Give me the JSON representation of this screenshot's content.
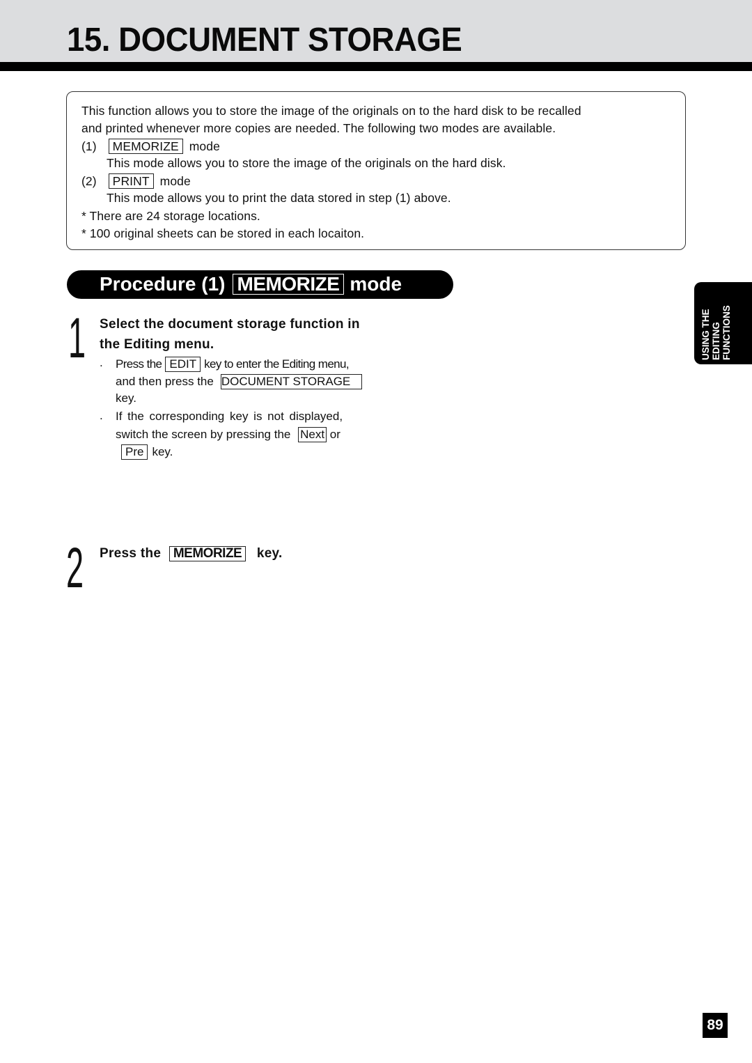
{
  "header": {
    "title": "15. DOCUMENT STORAGE"
  },
  "intro": {
    "line1": "This function allows you to store the image of the originals on to the hard disk to be recalled",
    "line2": "and printed whenever more copies are needed. The following two modes are available.",
    "mode1": {
      "num": "(1)",
      "key": "MEMORIZE",
      "suffix": "mode",
      "desc": "This mode allows you to store the image of the originals on the hard disk."
    },
    "mode2": {
      "num": "(2)",
      "key": "PRINT",
      "suffix": "mode",
      "desc": "This mode allows you to print the data stored in step (1) above."
    },
    "note1": "* There are 24 storage locations.",
    "note2": "* 100 original sheets can be stored in each locaiton."
  },
  "procedure": {
    "prefix": "Procedure (1)",
    "key": "MEMORIZE",
    "suffix": "mode"
  },
  "step1": {
    "number": "1",
    "title_line1": "Select the document storage function in",
    "title_line2": "the Editing menu.",
    "bullet": ".",
    "b1_pre": "Press the",
    "b1_key": "EDIT",
    "b1_post": "key to enter the Editing menu,",
    "b1_line2_pre": "and then press the",
    "b1_line2_key": "DOCUMENT STORAGE",
    "b1_line3": "key.",
    "b2_line1": "If the corresponding key is not displayed,",
    "b2_line2_pre": "switch the screen by pressing the",
    "b2_key_next": "Next",
    "b2_or": "or",
    "b2_key_pre": "Pre",
    "b2_line3_post": "key."
  },
  "step2": {
    "number": "2",
    "pre": "Press the",
    "key": "MEMORIZE",
    "post": "key."
  },
  "side_tab": {
    "line1": "USING THE",
    "line2": "EDITING",
    "line3": "FUNCTIONS"
  },
  "page_number": "89"
}
